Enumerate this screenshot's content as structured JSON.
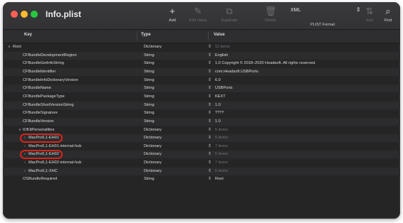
{
  "window": {
    "title": "Info.plist"
  },
  "toolbar": {
    "add": {
      "icon": "plus-icon",
      "glyph": "+",
      "label": "Add"
    },
    "edit_value": {
      "icon": "pencil-icon",
      "glyph": "✎",
      "label": "Edit Value"
    },
    "duplicate": {
      "icon": "duplicate-icon",
      "glyph": "⧉",
      "label": "Duplicate"
    },
    "delete": {
      "icon": "trash-icon",
      "glyph": "🗑",
      "label": "Delete"
    },
    "format": {
      "value": "XML",
      "chevron": "⇕",
      "label": "PLIST Format"
    },
    "sort": {
      "icon": "sort-icon",
      "glyph": "⇅",
      "label": "Sort"
    },
    "find": {
      "icon": "search-icon",
      "glyph": "⌕",
      "label": "Find"
    }
  },
  "columns": {
    "key": "Key",
    "type": "Type",
    "value": "Value"
  },
  "rows": [
    {
      "key": "Root",
      "type": "Dictionary",
      "value": "11 items",
      "disclosure": "∨",
      "dim": true
    },
    {
      "key": "CFBundleDevelopmentRegion",
      "type": "String",
      "value": "English"
    },
    {
      "key": "CFBundleGetInfoString",
      "type": "String",
      "value": "1.0 Copyright © 2018–2020 Headsoft. All rights reserved."
    },
    {
      "key": "CFBundleIdentifier",
      "type": "String",
      "value": "com.Headsoft.USBPorts"
    },
    {
      "key": "CFBundleInfoDictionaryVersion",
      "type": "String",
      "value": "6.0"
    },
    {
      "key": "CFBundleName",
      "type": "String",
      "value": "USBPorts"
    },
    {
      "key": "CFBundlePackageType",
      "type": "String",
      "value": "KEXT"
    },
    {
      "key": "CFBundleShortVersionString",
      "type": "String",
      "value": "1.0"
    },
    {
      "key": "CFBundleSignature",
      "type": "String",
      "value": "????"
    },
    {
      "key": "CFBundleVersion",
      "type": "String",
      "value": "1.0"
    },
    {
      "key": "IOKitPersonalities",
      "type": "Dictionary",
      "value": "5 items",
      "disclosure": "∨",
      "dim": true
    },
    {
      "key": "MacPro6,1-EH01",
      "type": "Dictionary",
      "value": "5 items",
      "disclosure": "›",
      "dim": true,
      "highlight": true
    },
    {
      "key": "MacPro6,1-EH01-internal-hub",
      "type": "Dictionary",
      "value": "7 items",
      "disclosure": "›",
      "dim": true
    },
    {
      "key": "MacPro6,1-EH02",
      "type": "Dictionary",
      "value": "5 items",
      "disclosure": "›",
      "dim": true,
      "highlight": true
    },
    {
      "key": "MacPro6,1-EH02-internal-hub",
      "type": "Dictionary",
      "value": "7 items",
      "disclosure": "›",
      "dim": true
    },
    {
      "key": "MacPro6,1-XHC",
      "type": "Dictionary",
      "value": "5 items",
      "disclosure": "›",
      "dim": true
    },
    {
      "key": "OSBundleRequired",
      "type": "String",
      "value": "Root"
    }
  ],
  "colors": {
    "highlight": "#d9231a",
    "background": "#252526"
  }
}
